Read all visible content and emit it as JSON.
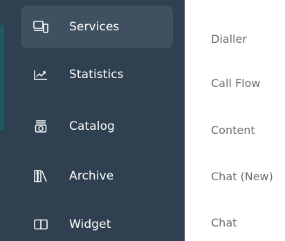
{
  "sidebar": {
    "items": [
      {
        "label": "Services",
        "icon": "devices-icon",
        "active": true
      },
      {
        "label": "Statistics",
        "icon": "chart-trend-icon",
        "active": false
      },
      {
        "label": "Catalog",
        "icon": "tray-icon",
        "active": false
      },
      {
        "label": "Archive",
        "icon": "library-icon",
        "active": false
      },
      {
        "label": "Widget",
        "icon": "columns-icon",
        "active": false
      }
    ]
  },
  "submenu": {
    "items": [
      {
        "label": "Dialler"
      },
      {
        "label": "Call Flow"
      },
      {
        "label": "Content"
      },
      {
        "label": "Chat (New)"
      },
      {
        "label": "Chat"
      }
    ]
  },
  "colors": {
    "sidebar_bg": "#2f4150",
    "active_item_bg": "#3f5060",
    "submenu_text": "#6b6b6b",
    "accent_strip": "#1d5a63"
  }
}
